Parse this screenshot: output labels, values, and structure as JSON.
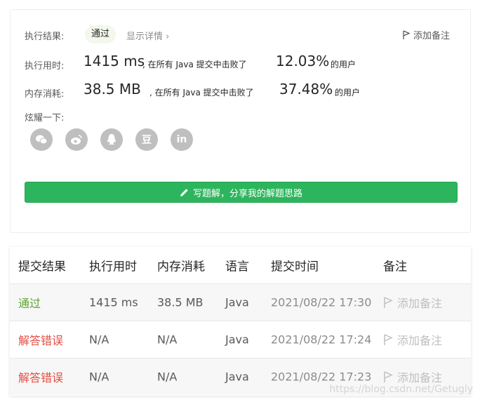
{
  "result": {
    "label": "执行结果:",
    "status": "通过",
    "detail_link": "显示详情 ›",
    "add_note": "添加备注"
  },
  "runtime": {
    "label": "执行用时:",
    "value": "1415 ms",
    "middle": ", 在所有 Java 提交中击败了",
    "percent": "12.03%",
    "suffix": "的用户"
  },
  "memory": {
    "label": "内存消耗:",
    "value": "38.5 MB",
    "middle": ", 在所有 Java 提交中击败了",
    "percent": "37.48%",
    "suffix": "的用户"
  },
  "share": {
    "label": "炫耀一下:",
    "icons": [
      "wechat-icon",
      "weibo-icon",
      "qq-icon",
      "douban-icon",
      "linkedin-icon"
    ],
    "douban_glyph": "豆",
    "linkedin_glyph": "in"
  },
  "write_solution": {
    "label": "写题解，分享我的解题思路",
    "color": "#2db55d"
  },
  "table": {
    "headers": [
      "提交结果",
      "执行用时",
      "内存消耗",
      "语言",
      "提交时间",
      "备注"
    ],
    "rows": [
      {
        "status": "通过",
        "status_color": "#5aa431",
        "runtime": "1415 ms",
        "memory": "38.5 MB",
        "lang": "Java",
        "time": "2021/08/22 17:30",
        "note": "添加备注"
      },
      {
        "status": "解答错误",
        "status_color": "#e54d42",
        "runtime": "N/A",
        "memory": "N/A",
        "lang": "Java",
        "time": "2021/08/22 17:24",
        "note": "添加备注"
      },
      {
        "status": "解答错误",
        "status_color": "#e54d42",
        "runtime": "N/A",
        "memory": "N/A",
        "lang": "Java",
        "time": "2021/08/22 17:23",
        "note": "添加备注"
      }
    ]
  },
  "watermark": "https://blog.csdn.net/Getugly"
}
